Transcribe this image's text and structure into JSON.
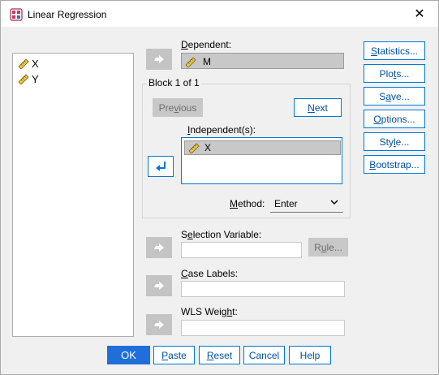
{
  "window": {
    "title": "Linear Regression",
    "close_glyph": "✕"
  },
  "source_vars": [
    {
      "label": "X",
      "icon": "scale-ruler-icon"
    },
    {
      "label": "Y",
      "icon": "scale-ruler-icon"
    }
  ],
  "dependent": {
    "label_pre": "",
    "label_key": "D",
    "label_post": "ependent:",
    "value": "M"
  },
  "block": {
    "title": "Block 1 of 1",
    "previous_pre": "Pre",
    "previous_key": "v",
    "previous_post": "ious",
    "next_key": "N",
    "next_post": "ext"
  },
  "independents": {
    "label_key": "I",
    "label_post": "ndependent(s):",
    "items": [
      "X"
    ]
  },
  "method": {
    "label_pre": "",
    "label_key": "M",
    "label_post": "ethod:",
    "selected": "Enter"
  },
  "selection_variable": {
    "label_pre": "S",
    "label_key": "e",
    "label_post": "lection Variable:",
    "value": "",
    "rule_pre": "R",
    "rule_key": "u",
    "rule_post": "le..."
  },
  "case_labels": {
    "label_key": "C",
    "label_post": "ase Labels:",
    "value": ""
  },
  "wls_weight": {
    "label_pre": "WLS Weig",
    "label_key": "h",
    "label_post": "t:",
    "value": ""
  },
  "side_buttons": [
    {
      "name": "statistics-button",
      "pre": "",
      "key": "S",
      "post": "tatistics..."
    },
    {
      "name": "plots-button",
      "pre": "Plo",
      "key": "t",
      "post": "s..."
    },
    {
      "name": "save-button",
      "pre": "S",
      "key": "a",
      "post": "ve..."
    },
    {
      "name": "options-button",
      "pre": "",
      "key": "O",
      "post": "ptions..."
    },
    {
      "name": "style-button",
      "pre": "Sty",
      "key": "l",
      "post": "e..."
    },
    {
      "name": "bootstrap-button",
      "pre": "",
      "key": "B",
      "post": "ootstrap..."
    }
  ],
  "bottom_buttons": {
    "ok": "OK",
    "paste_key": "P",
    "paste_post": "aste",
    "reset_key": "R",
    "reset_post": "eset",
    "cancel": "Cancel",
    "help": "Help"
  },
  "colors": {
    "accent": "#0078d7",
    "primary_button": "#1e6fd9",
    "disabled": "#c8c8c8",
    "ruler_yellow": "#e8c84a"
  }
}
